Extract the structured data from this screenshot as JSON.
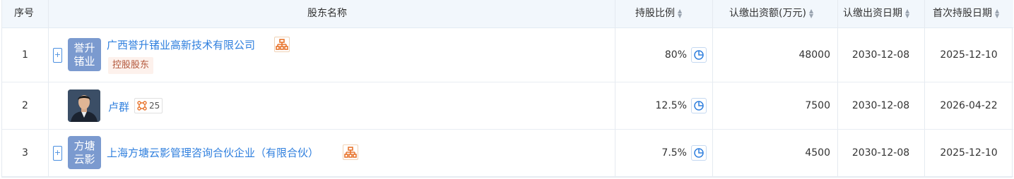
{
  "headers": {
    "index": "序号",
    "name": "股东名称",
    "ratio": "持股比例",
    "amount": "认缴出资额(万元)",
    "due_date": "认缴出资日期",
    "first_date": "首次持股日期"
  },
  "rows": [
    {
      "index": "1",
      "logo_text": "誉升\n锗业",
      "name": "广西誉升锗业高新技术有限公司",
      "tag": "控股股东",
      "ratio": "80%",
      "amount": "48000",
      "due_date": "2030-12-08",
      "first_date": "2025-12-10"
    },
    {
      "index": "2",
      "name": "卢群",
      "relation_count": "25",
      "ratio": "12.5%",
      "amount": "7500",
      "due_date": "2030-12-08",
      "first_date": "2026-04-22"
    },
    {
      "index": "3",
      "logo_text": "方塘\n云影",
      "name": "上海方塘云影管理咨询合伙企业（有限合伙）",
      "ratio": "7.5%",
      "amount": "4500",
      "due_date": "2030-12-08",
      "first_date": "2025-12-10"
    }
  ],
  "colors": {
    "header_bg": "#f2f7fc",
    "link": "#2f7fde",
    "logo_bg": "#7b9acf",
    "tag_bg": "#fdf1ec",
    "tag_text": "#b2563a",
    "org_icon": "#e8742d"
  },
  "icons": {
    "sort": "sort-icon",
    "expand": "expand-plus-icon",
    "org_structure": "org-structure-icon",
    "relation": "relation-network-icon",
    "pie": "pie-chart-icon"
  }
}
